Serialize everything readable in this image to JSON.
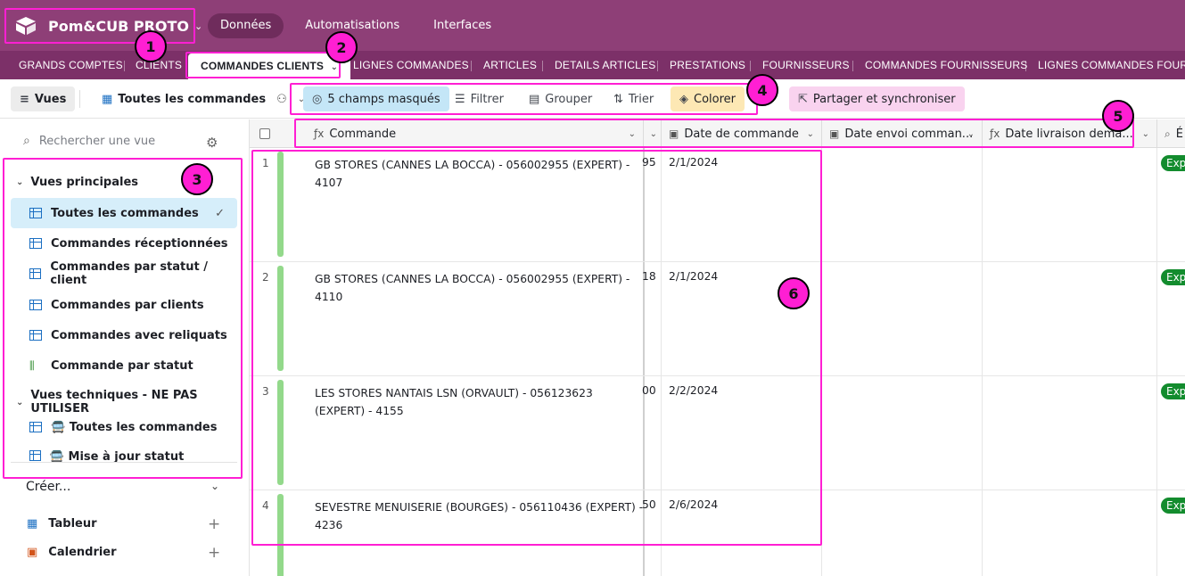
{
  "base": {
    "name": "Pom&CUB PROTO"
  },
  "topnav": [
    "Données",
    "Automatisations",
    "Interfaces"
  ],
  "tabs": [
    "GRANDS COMPTES",
    "CLIENTS",
    "COMMANDES CLIENTS",
    "LIGNES COMMANDES",
    "ARTICLES",
    "DETAILS ARTICLES",
    "PRESTATIONS",
    "FOURNISSEURS",
    "COMMANDES FOURNISSEURS",
    "LIGNES COMMANDES FOURNI"
  ],
  "toolbar": {
    "vues": "Vues",
    "view_name": "Toutes les commandes",
    "hidden_fields": "5 champs masqués",
    "filter": "Filtrer",
    "group": "Grouper",
    "sort": "Trier",
    "color": "Colorer",
    "share": "Partager et synchroniser"
  },
  "sidebar": {
    "search_placeholder": "Rechercher une vue",
    "section_main": "Vues principales",
    "main_views": [
      "Toutes les commandes",
      "Commandes réceptionnées",
      "Commandes par statut / client",
      "Commandes par clients",
      "Commandes avec reliquats",
      "Commande par statut"
    ],
    "section_tech": "Vues techniques - NE PAS UTILISER",
    "tech_views": [
      "🚍 Toutes les commandes",
      "🚍 Mise à jour statut expédition"
    ],
    "create": "Créer...",
    "create_items": [
      "Tableur",
      "Calendrier"
    ]
  },
  "grid": {
    "columns": [
      "Commande",
      "Date de commande",
      "Date envoi comman...",
      "Date livraison dema...",
      "É"
    ],
    "rows": [
      {
        "num": "1",
        "commande": "GB STORES (CANNES LA BOCCA) - 056002955 (EXPERT) - 4107",
        "partial": "95",
        "date": "2/1/2024",
        "status": "Exp"
      },
      {
        "num": "2",
        "commande": "GB STORES (CANNES LA BOCCA) - 056002955 (EXPERT) - 4110",
        "partial": "18",
        "date": "2/1/2024",
        "status": "Exp"
      },
      {
        "num": "3",
        "commande": "LES STORES NANTAIS LSN (ORVAULT) - 056123623 (EXPERT) - 4155",
        "partial": "00",
        "date": "2/2/2024",
        "status": "Exp"
      },
      {
        "num": "4",
        "commande": "SEVESTRE MENUISERIE (BOURGES) - 056110436 (EXPERT) - 4236",
        "partial": "50",
        "date": "2/6/2024",
        "status": "Exp"
      }
    ]
  },
  "annotations": [
    "1",
    "2",
    "3",
    "4",
    "5",
    "6"
  ],
  "colors": {
    "accent": "#ff1fd3",
    "topbar": "#8e3f77",
    "tabsbar": "#7c3068",
    "status_green": "#138c2e"
  }
}
